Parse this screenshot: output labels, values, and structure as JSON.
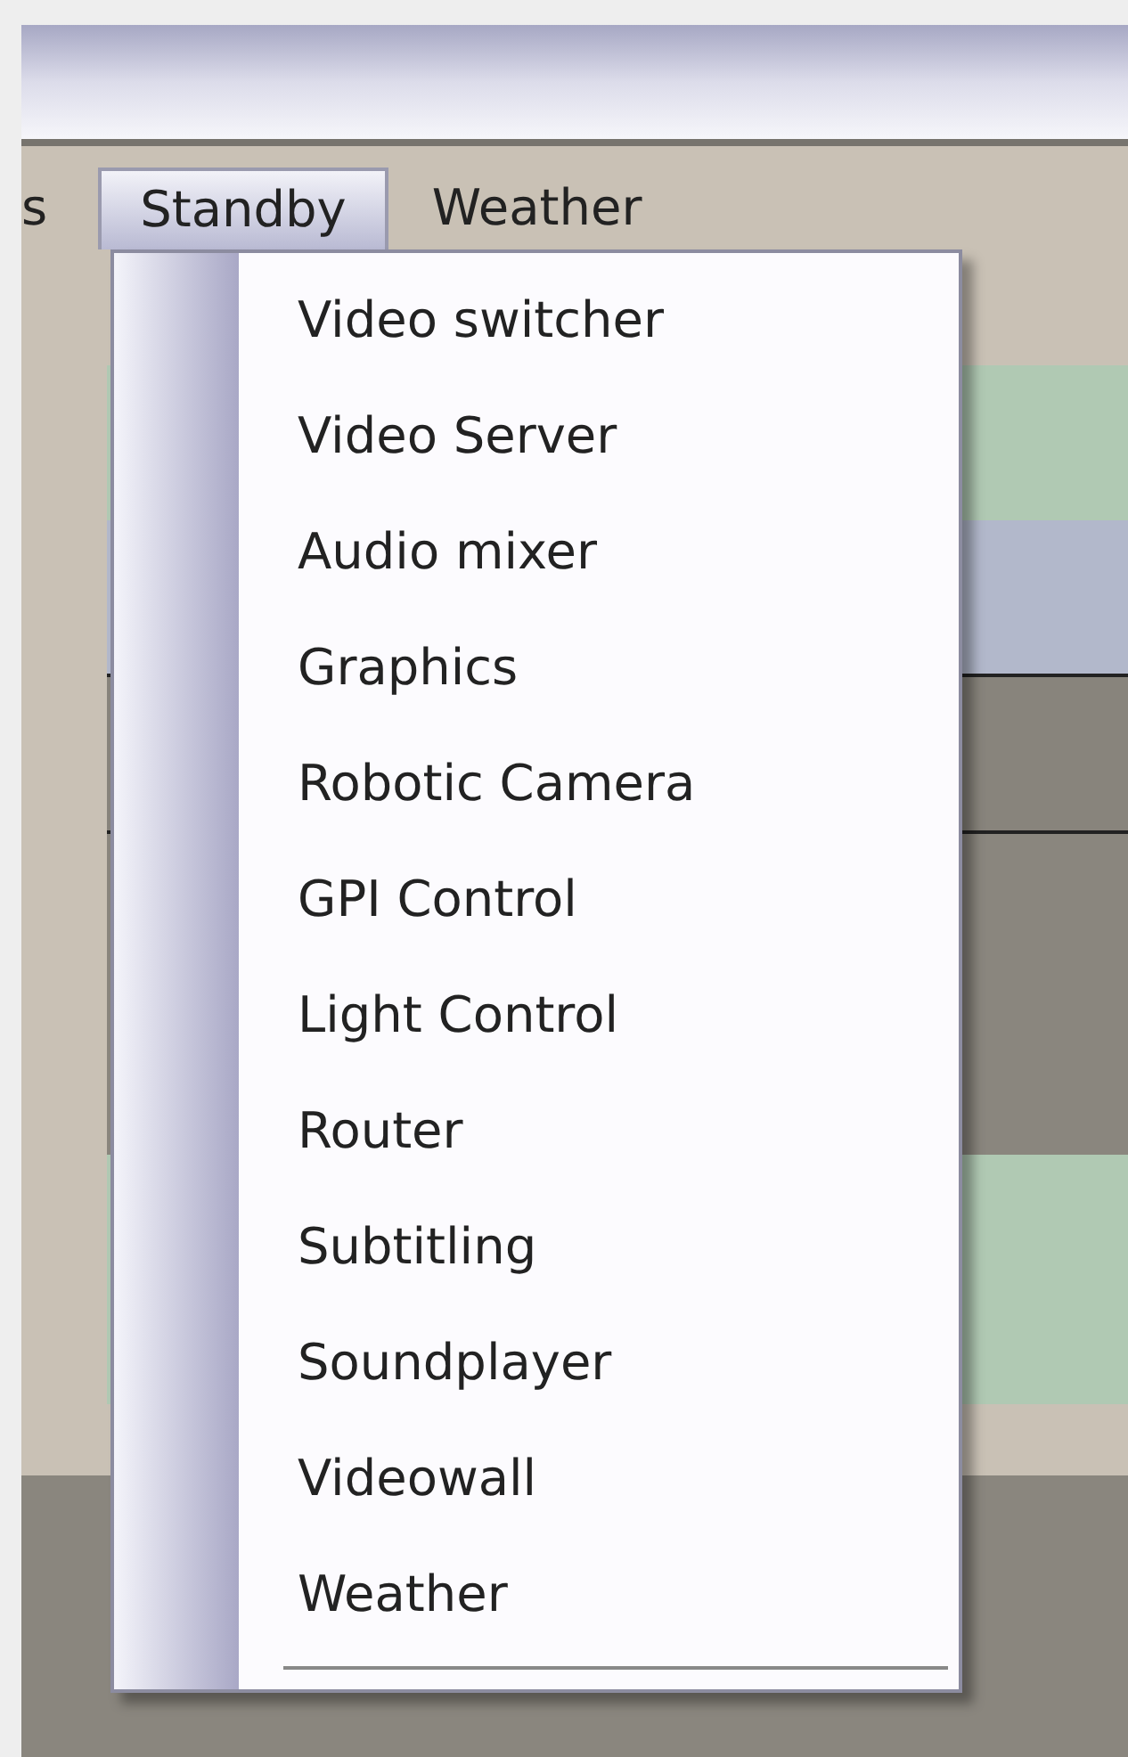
{
  "menu_bar": [
    {
      "label": "s",
      "selected": false
    },
    {
      "label": "Standby",
      "selected": true
    },
    {
      "label": "Weather",
      "selected": false
    }
  ],
  "dropdown": {
    "items": [
      "Video switcher",
      "Video Server",
      "Audio mixer",
      "Graphics",
      "Robotic Camera",
      "GPI Control",
      "Light Control",
      "Router",
      "Subtitling",
      "Soundplayer",
      "Videowall",
      "Weather"
    ]
  }
}
